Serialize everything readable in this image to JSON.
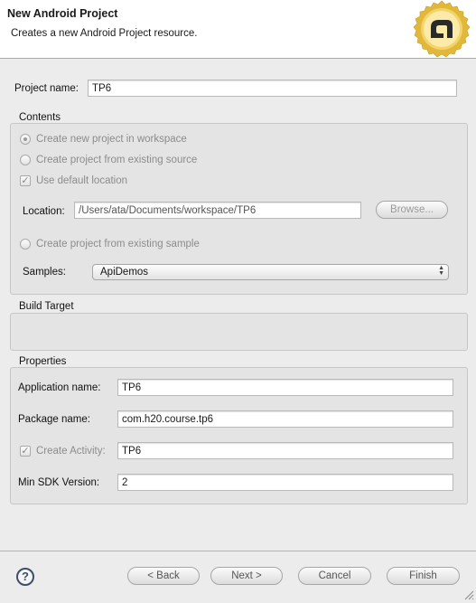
{
  "header": {
    "title": "New Android Project",
    "subtitle": "Creates a new Android Project resource."
  },
  "project_name": {
    "label": "Project name:",
    "value": "TP6"
  },
  "contents": {
    "legend": "Contents",
    "radio_new": "Create new project in workspace",
    "radio_existing_source": "Create project from existing source",
    "use_default_location": "Use default location",
    "location_label": "Location:",
    "location_value": "/Users/ata/Documents/workspace/TP6",
    "browse_button": "Browse...",
    "radio_existing_sample": "Create project from existing sample",
    "samples_label": "Samples:",
    "samples_value": "ApiDemos"
  },
  "build_target": {
    "legend": "Build Target"
  },
  "properties": {
    "legend": "Properties",
    "app_name_label": "Application name:",
    "app_name_value": "TP6",
    "package_label": "Package name:",
    "package_value": "com.h20.course.tp6",
    "create_activity_label": "Create Activity:",
    "create_activity_value": "TP6",
    "min_sdk_label": "Min SDK Version:",
    "min_sdk_value": "2"
  },
  "footer": {
    "help": "?",
    "back": "< Back",
    "next": "Next >",
    "cancel": "Cancel",
    "finish": "Finish"
  },
  "icons": {
    "logo": "android-adt-seal-icon",
    "help": "help-icon",
    "resize": "resize-grip-icon"
  },
  "colors": {
    "logo_gold": "#e2b83a",
    "logo_dark": "#2a2a2a",
    "help_blue": "#3d4e6a"
  }
}
